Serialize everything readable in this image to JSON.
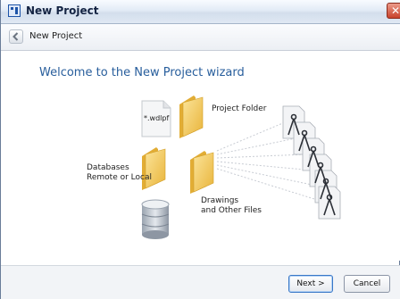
{
  "window": {
    "title": "New Project",
    "close_symbol": "✕"
  },
  "nav": {
    "title": "New Project",
    "back_icon": "chevron-left-icon"
  },
  "content": {
    "heading": "Welcome to the New Project wizard",
    "file_label": "*.wdlpf",
    "project_folder_label": "Project Folder",
    "databases_label_line1": "Databases",
    "databases_label_line2": "Remote or Local",
    "drawings_label_line1": "Drawings",
    "drawings_label_line2": "and Other Files"
  },
  "buttons": {
    "next": "Next >",
    "cancel": "Cancel"
  },
  "colors": {
    "heading": "#285e9c",
    "folder": "#f2c84b",
    "close": "#c8432c"
  }
}
